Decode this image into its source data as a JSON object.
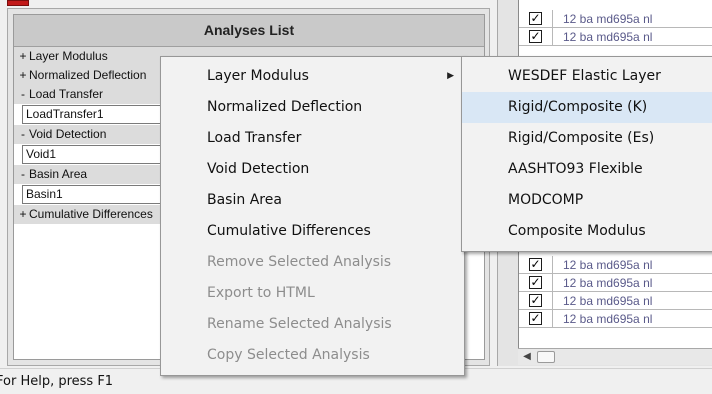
{
  "analyses_panel": {
    "header": "Analyses List",
    "tree": [
      {
        "expander": "+",
        "label": "Layer Modulus",
        "children": []
      },
      {
        "expander": "+",
        "label": "Normalized Deflection",
        "children": []
      },
      {
        "expander": "-",
        "label": "Load Transfer",
        "children": [
          "LoadTransfer1"
        ]
      },
      {
        "expander": "-",
        "label": "Void Detection",
        "children": [
          "Void1"
        ]
      },
      {
        "expander": "-",
        "label": "Basin Area",
        "children": [
          "Basin1"
        ]
      },
      {
        "expander": "+",
        "label": "Cumulative Differences",
        "children": []
      }
    ]
  },
  "context_menu": {
    "items": [
      {
        "label": "Layer Modulus",
        "enabled": true,
        "has_submenu": true
      },
      {
        "label": "Normalized Deflection",
        "enabled": true
      },
      {
        "label": "Load Transfer",
        "enabled": true
      },
      {
        "label": "Void Detection",
        "enabled": true
      },
      {
        "label": "Basin Area",
        "enabled": true
      },
      {
        "label": "Cumulative Differences",
        "enabled": true
      },
      {
        "label": "Remove Selected Analysis",
        "enabled": false
      },
      {
        "label": "Export to HTML",
        "enabled": false
      },
      {
        "label": "Rename Selected Analysis",
        "enabled": false
      },
      {
        "label": "Copy Selected Analysis",
        "enabled": false
      }
    ]
  },
  "submenu": {
    "items": [
      {
        "label": "WESDEF Elastic Layer",
        "highlighted": false
      },
      {
        "label": "Rigid/Composite (K)",
        "highlighted": true
      },
      {
        "label": "Rigid/Composite (Es)",
        "highlighted": false
      },
      {
        "label": "AASHTO93 Flexible",
        "highlighted": false
      },
      {
        "label": "MODCOMP",
        "highlighted": false
      },
      {
        "label": "Composite Modulus",
        "highlighted": false
      }
    ]
  },
  "grid": {
    "check_mark": "✓",
    "rows": [
      {
        "checked": true,
        "text": "12 ba md695a nl"
      },
      {
        "checked": true,
        "text": "12 ba md695a nl"
      },
      {
        "checked": true,
        "text": "12 ba md695a nl"
      },
      {
        "checked": true,
        "text": "12 ba md695a nl"
      },
      {
        "checked": true,
        "text": "12 ba md695a nl"
      },
      {
        "checked": true,
        "text": "12 ba md695a nl"
      }
    ]
  },
  "status_bar": {
    "text": "For Help, press F1"
  },
  "colors": {
    "highlight": "#d9e7f5",
    "disabled_text": "#8d8d8d",
    "list_header_bg": "#c9c9c9"
  }
}
